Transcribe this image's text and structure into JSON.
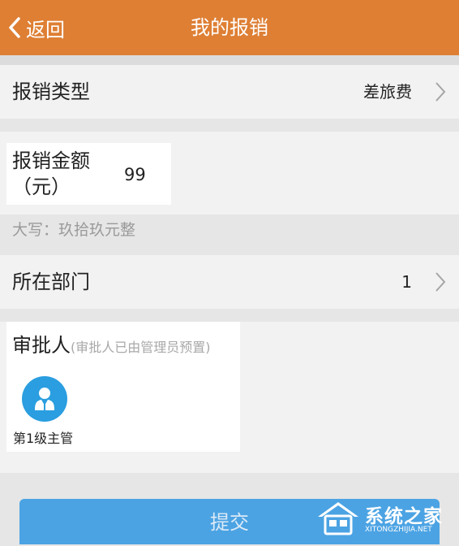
{
  "navbar": {
    "back_label": "返回",
    "title": "我的报销"
  },
  "expense_type": {
    "label": "报销类型",
    "value": "差旅费"
  },
  "amount": {
    "label": "报销金额（元）",
    "value": "99",
    "uppercase_text": "大写：玖拾玖元整"
  },
  "department": {
    "label": "所在部门",
    "value": "1"
  },
  "approver": {
    "label": "审批人",
    "hint": "(审批人已由管理员预置)",
    "name": "第1级主管",
    "avatar_icon": "user-icon"
  },
  "submit": {
    "label": "提交"
  },
  "watermark": {
    "name": "系统之家",
    "url": "XITONGZHIJIA.NET"
  },
  "colors": {
    "navbar": "#de7f34",
    "submit": "#4ba3e3",
    "avatar": "#2a9ee0"
  }
}
